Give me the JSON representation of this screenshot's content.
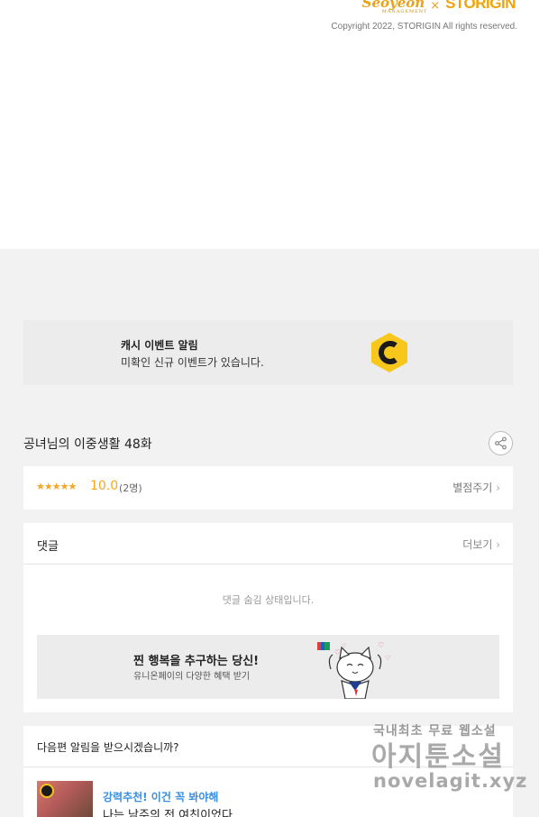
{
  "footer": {
    "logo_left": "Seoyeon",
    "logo_left_sub": "MANAGEMENT",
    "logo_separator": "×",
    "logo_right": "STORIGIN",
    "copyright": "Copyright 2022, STORIGIN All rights reserved."
  },
  "cash_banner": {
    "title": "캐시 이벤트 알림",
    "description": "미확인 신규 이벤트가 있습니다.",
    "badge_icon": "c-hexagon-icon",
    "badge_letter": "C",
    "badge_color": "#f7c71c"
  },
  "episode": {
    "title": "공녀님의 이중생활 48화",
    "share_icon": "share-icon"
  },
  "rating": {
    "stars": "★★★★★",
    "score": "10.0",
    "count": "(2명)",
    "rate_link": "별점주기",
    "accent": "#f5a623"
  },
  "comments": {
    "title": "댓글",
    "more_link": "더보기",
    "hidden_message": "댓글 숨김 상태입니다."
  },
  "ad": {
    "title": "찐 행복을 추구하는 당신!",
    "description": "유니온페이의 다양한 혜택 받기"
  },
  "notify": {
    "title": "다음편 알림을 받으시겠습니까?",
    "recommend_tag": "강력추천! 이건 꼭 봐야해",
    "recommend_name": "나는 남주의 전 여친이었다"
  },
  "watermark": {
    "line1": "국내최초 무료 웹소설",
    "line2": "아지툰소설",
    "line3": "novelagit.xyz"
  }
}
